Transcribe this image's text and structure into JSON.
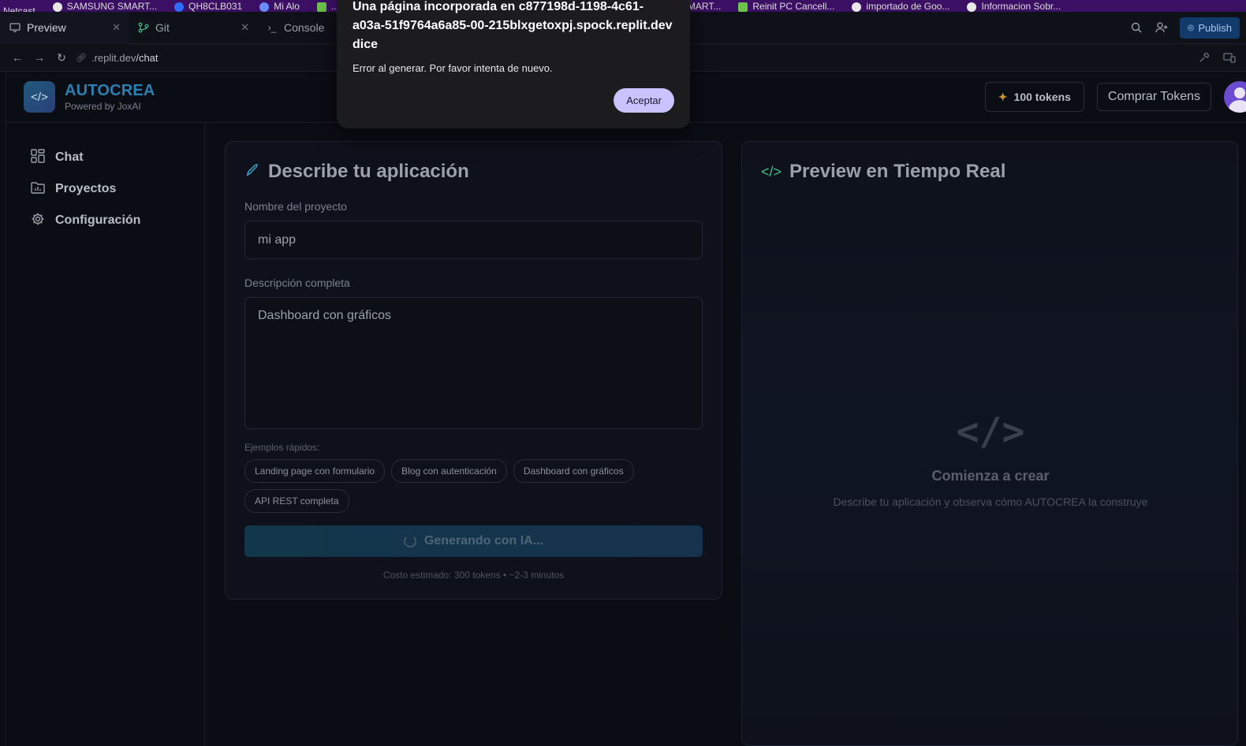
{
  "bookmarks": [
    "Netcast",
    "SAMSUNG SMART...",
    "QH8CLB031",
    "Mi Alo",
    "...",
    "SAMSUNG SMART...",
    "Reinit PC Cancell...",
    "importado de Goo...",
    "Informacion Sobr..."
  ],
  "ide": {
    "tabs": [
      {
        "label": "Preview",
        "icon": "monitor-icon"
      },
      {
        "label": "Git",
        "icon": "git-branch-icon"
      },
      {
        "label": "Console",
        "icon": "terminal-icon"
      }
    ],
    "publish_label": "Publish",
    "url_prefix": ".replit.dev",
    "url_path": "/chat"
  },
  "app": {
    "brand_name": "AUTOCREA",
    "brand_sub": "Powered by JoxAI",
    "tokens_label": "100 tokens",
    "buy_label": "Comprar Tokens",
    "sidebar": [
      {
        "label": "Chat",
        "icon": "grid-icon"
      },
      {
        "label": "Proyectos",
        "icon": "folder-chart-icon"
      },
      {
        "label": "Configuración",
        "icon": "gear-icon"
      }
    ],
    "form": {
      "title": "Describe tu aplicación",
      "name_label": "Nombre del proyecto",
      "name_value": "mi app",
      "desc_label": "Descripción completa",
      "desc_value": "Dashboard con gráficos",
      "quick_label": "Ejemplos rápidos:",
      "chips": [
        "Landing page con formulario",
        "Blog con autenticación",
        "Dashboard con gráficos",
        "API REST completa"
      ],
      "generate_label": "Generando con IA...",
      "cost_label": "Costo estimado: 300 tokens • ~2-3 minutos"
    },
    "preview": {
      "title": "Preview en Tiempo Real",
      "empty_title": "Comienza a crear",
      "empty_sub": "Describe tu aplicación y observa cómo AUTOCREA la construye"
    }
  },
  "dialog": {
    "title": "Una página incorporada en c877198d-1198-4c61-a03a-51f9764a6a85-00-215blxgetoxpj.spock.replit.dev dice",
    "message": "Error al generar. Por favor intenta de nuevo.",
    "ok_label": "Aceptar"
  },
  "colors": {
    "accent": "#2b7fb3",
    "dialog_button": "#c9c3ff",
    "publish_bg": "#123a6a"
  }
}
